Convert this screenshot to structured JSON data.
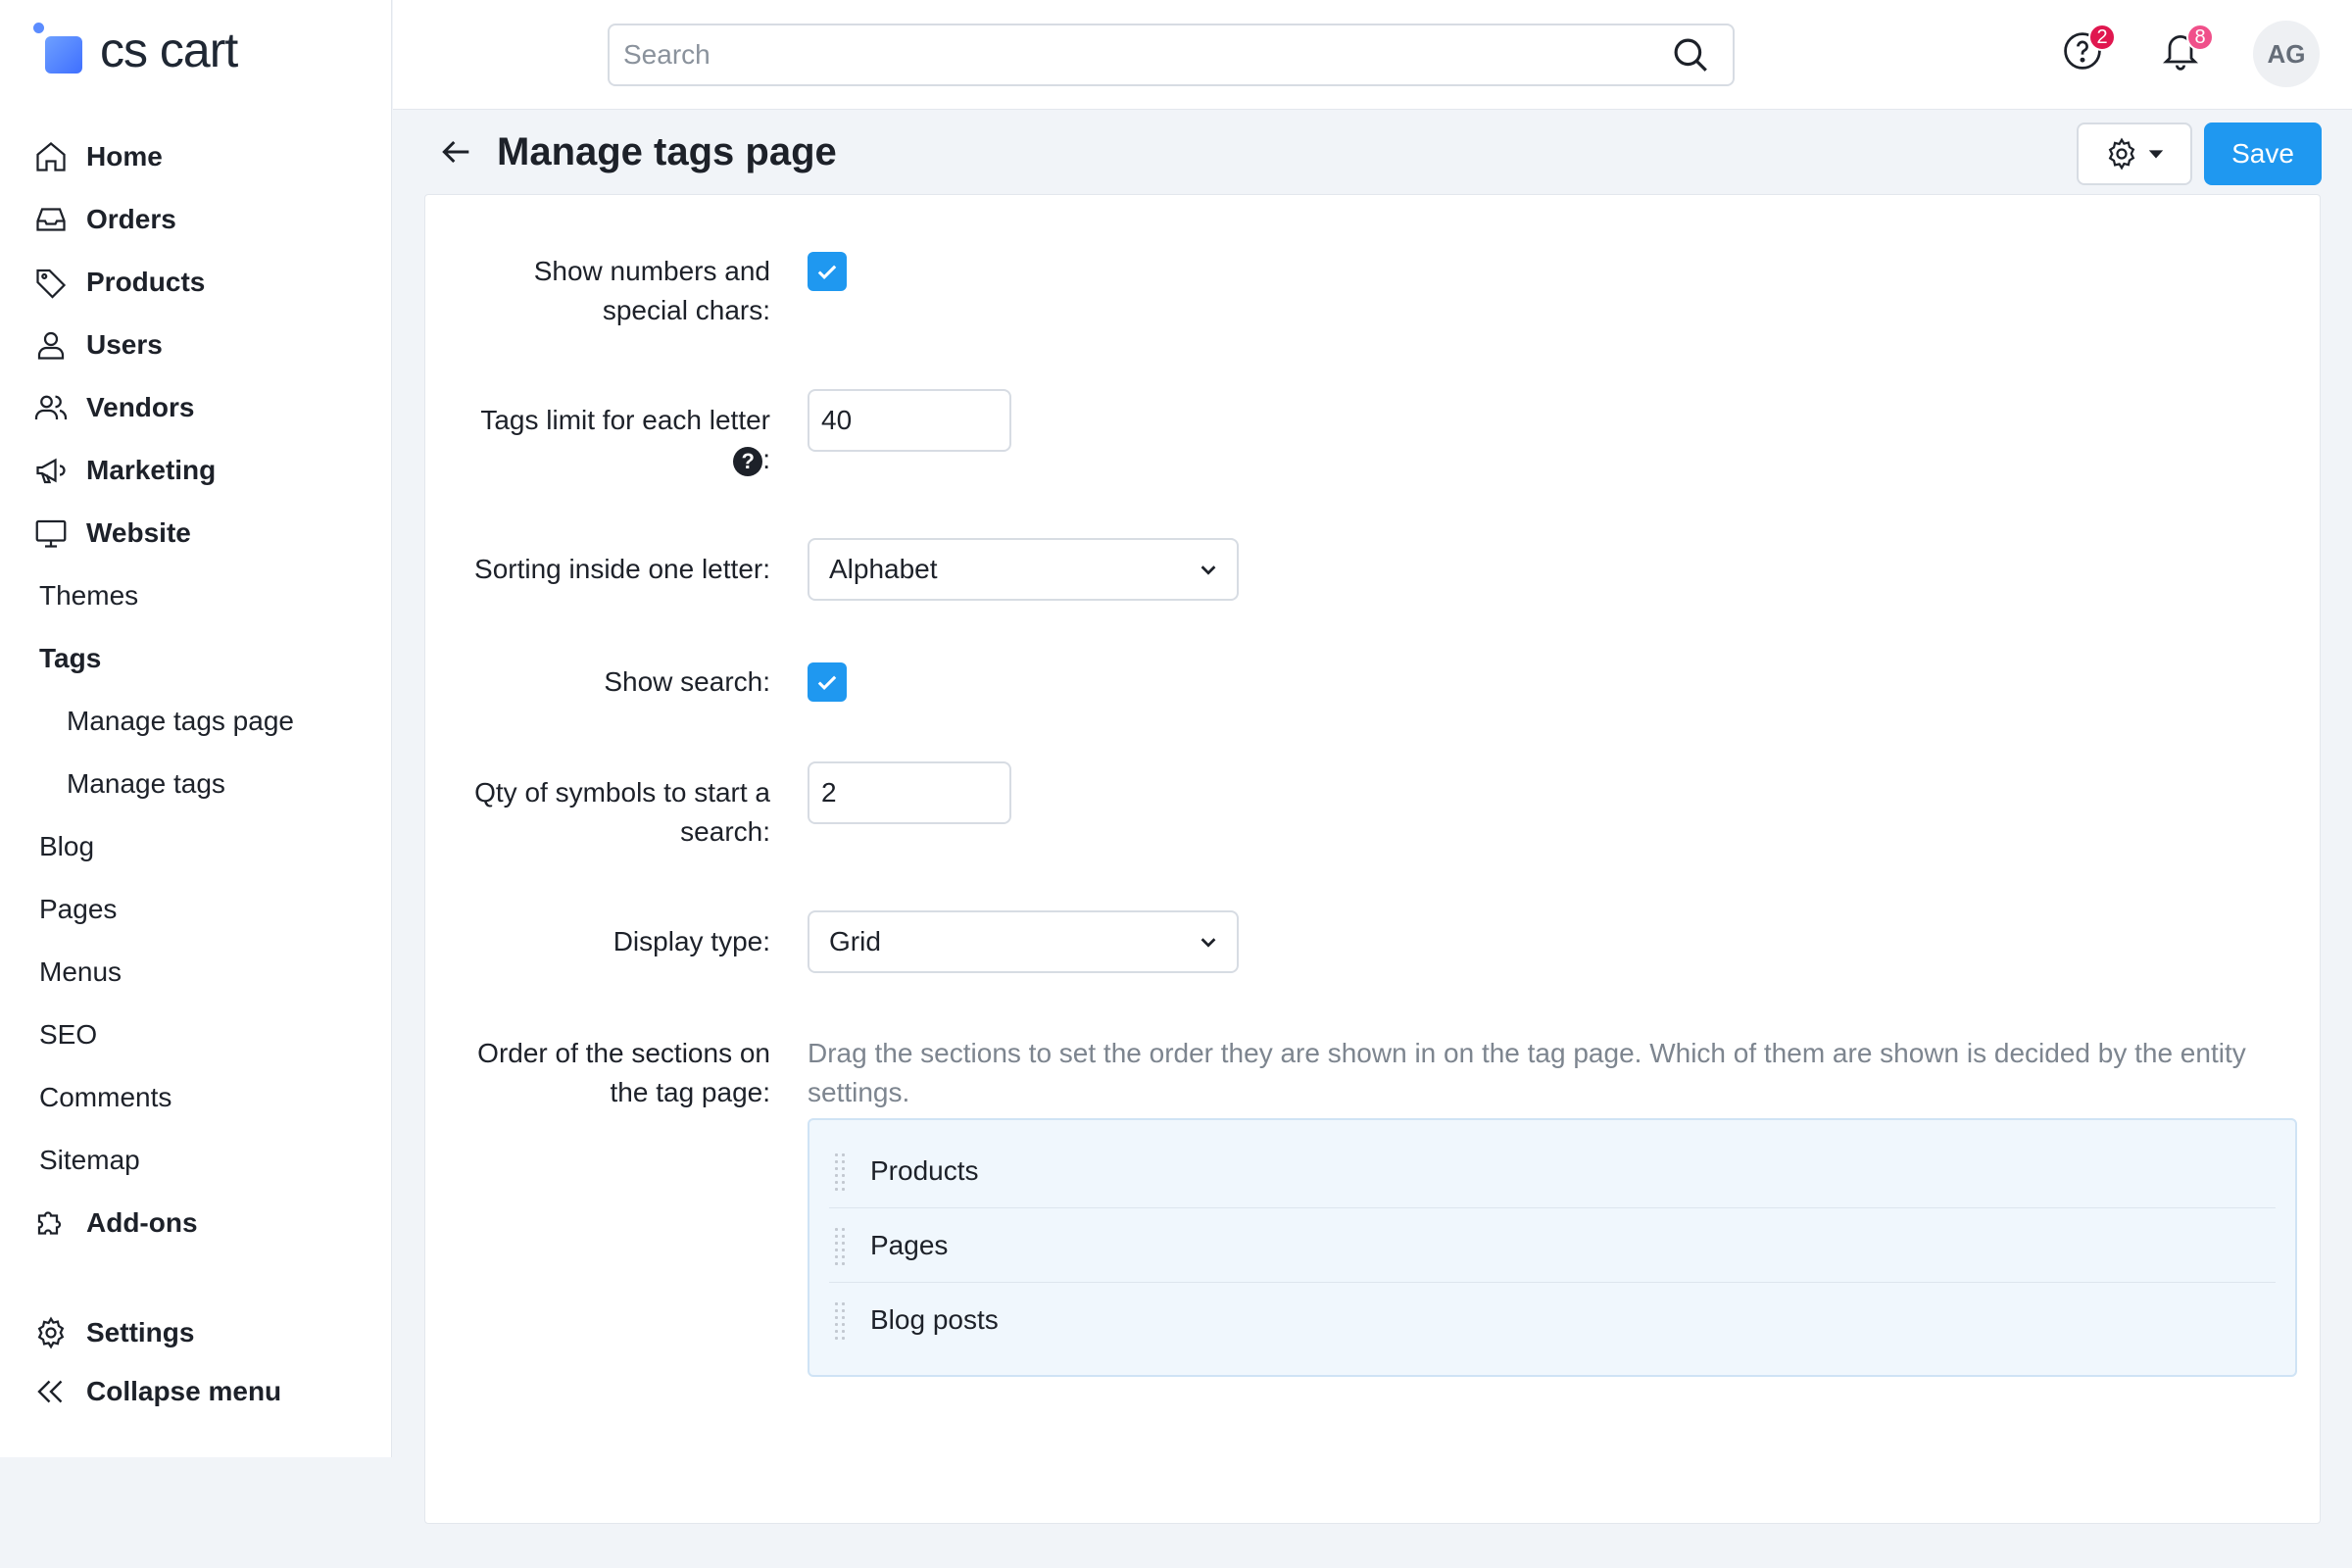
{
  "app": {
    "logo_text": "cs cart"
  },
  "sidebar": {
    "main_items": [
      {
        "label": "Home",
        "icon": "home-icon"
      },
      {
        "label": "Orders",
        "icon": "inbox-icon"
      },
      {
        "label": "Products",
        "icon": "tag-icon"
      },
      {
        "label": "Users",
        "icon": "user-icon"
      },
      {
        "label": "Vendors",
        "icon": "users-icon"
      },
      {
        "label": "Marketing",
        "icon": "megaphone-icon"
      },
      {
        "label": "Website",
        "icon": "monitor-icon"
      }
    ],
    "website_children": [
      {
        "label": "Themes"
      },
      {
        "label": "Tags",
        "active": true
      },
      {
        "label": "Blog"
      },
      {
        "label": "Pages"
      },
      {
        "label": "Menus"
      },
      {
        "label": "SEO"
      },
      {
        "label": "Comments"
      },
      {
        "label": "Sitemap"
      }
    ],
    "tags_children": [
      {
        "label": "Manage tags page",
        "active": true
      },
      {
        "label": "Manage tags"
      }
    ],
    "addons_label": "Add-ons",
    "settings_label": "Settings",
    "collapse_label": "Collapse menu"
  },
  "topbar": {
    "search_placeholder": "Search",
    "help_badge": "2",
    "notifications_badge": "8",
    "avatar_initials": "AG",
    "help_badge_color": "#e0174f",
    "notifications_badge_color": "#f0508a"
  },
  "header": {
    "title": "Manage tags page",
    "save_label": "Save"
  },
  "form": {
    "show_numbers_label_1": "Show numbers and",
    "show_numbers_label_2": "special chars:",
    "show_numbers_checked": true,
    "tags_limit_label": "Tags limit for each letter",
    "tags_limit_colon": ":",
    "tags_limit_value": "40",
    "sorting_label": "Sorting inside one letter:",
    "sorting_value": "Alphabet",
    "show_search_label": "Show search:",
    "show_search_checked": true,
    "qty_label_1": "Qty of symbols to start a",
    "qty_label_2": "search:",
    "qty_value": "2",
    "display_type_label": "Display type:",
    "display_type_value": "Grid",
    "order_label_1": "Order of the sections on",
    "order_label_2": "the tag page:",
    "order_hint": "Drag the sections to set the order they are shown in on the tag page. Which of them are shown is decided by the entity settings.",
    "sections": [
      "Products",
      "Pages",
      "Blog posts"
    ]
  },
  "colors": {
    "accent": "#1f98f0",
    "sort_box_bg": "#f0f7fd"
  }
}
